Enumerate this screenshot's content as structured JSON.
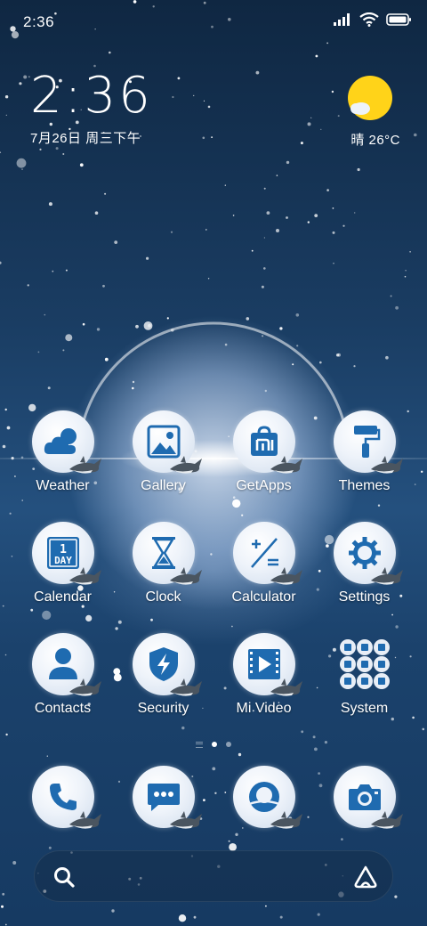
{
  "status_bar": {
    "time": "2:36",
    "icons": [
      "signal-icon",
      "wifi-icon",
      "battery-icon"
    ]
  },
  "clock_widget": {
    "time": "2:36",
    "date": "7月26日 周三下午"
  },
  "weather_widget": {
    "condition_temp": "晴 26°C",
    "icon": "sun-icon"
  },
  "apps": [
    [
      {
        "label": "Weather",
        "icon": "weather-icon"
      },
      {
        "label": "Gallery",
        "icon": "gallery-icon"
      },
      {
        "label": "GetApps",
        "icon": "getapps-icon"
      },
      {
        "label": "Themes",
        "icon": "themes-icon"
      }
    ],
    [
      {
        "label": "Calendar",
        "icon": "calendar-icon",
        "badge": "1 DAY"
      },
      {
        "label": "Clock",
        "icon": "clock-icon"
      },
      {
        "label": "Calculator",
        "icon": "calculator-icon"
      },
      {
        "label": "Settings",
        "icon": "settings-icon"
      }
    ],
    [
      {
        "label": "Contacts",
        "icon": "contacts-icon"
      },
      {
        "label": "Security",
        "icon": "security-icon"
      },
      {
        "label": "Mi Video",
        "icon": "mi-video-icon"
      },
      {
        "label": "System",
        "icon": "folder-icon"
      }
    ]
  ],
  "calendar_icon_text": {
    "num": "1",
    "word": "DAY"
  },
  "dock": [
    {
      "icon": "phone-icon"
    },
    {
      "icon": "messages-icon"
    },
    {
      "icon": "browser-icon"
    },
    {
      "icon": "camera-icon"
    }
  ],
  "page_indicator": {
    "pages": 2,
    "current": 1
  },
  "search_bar": {
    "icons": [
      "search-icon",
      "assistant-icon"
    ]
  },
  "colors": {
    "icon_blue": "#1f6bb0",
    "sun_yellow": "#ffd319",
    "bubble": "#eef3fa"
  }
}
